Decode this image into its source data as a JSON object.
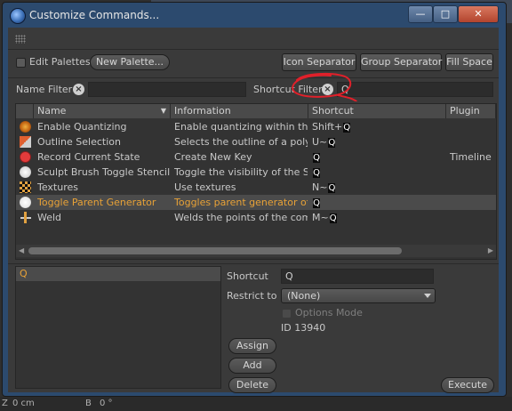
{
  "background": {
    "bottom_fields": [
      "Z",
      "0 cm",
      "B",
      "0 °"
    ]
  },
  "window": {
    "title": "Customize Commands..."
  },
  "toolbar": {
    "edit_palettes_label": "Edit Palettes",
    "new_palette_label": "New Palette...",
    "icon_separator_label": "Icon Separator",
    "group_separator_label": "Group Separator",
    "fill_space_label": "Fill Space"
  },
  "filters": {
    "name_filter_label": "Name Filter",
    "name_filter_value": "",
    "shortcut_filter_label": "Shortcut Filter",
    "shortcut_filter_value": "Q"
  },
  "table": {
    "headers": {
      "name": "Name",
      "information": "Information",
      "shortcut": "Shortcut",
      "plugin": "Plugin"
    },
    "rows": [
      {
        "name": "Enable Quantizing",
        "information": "Enable quantizing within the e",
        "shortcut_prefix": "Shift+",
        "key": "Q",
        "plugin": ""
      },
      {
        "name": "Outline Selection",
        "information": "Selects the outline of a polygo",
        "shortcut_prefix": "U~",
        "key": "Q",
        "plugin": ""
      },
      {
        "name": "Record Current State",
        "information": "Create New Key",
        "shortcut_prefix": "",
        "key": "Q",
        "plugin": "Timeline"
      },
      {
        "name": "Sculpt Brush Toggle Stencil V",
        "information": "Toggle the visibility of the Ste",
        "shortcut_prefix": "",
        "key": "Q",
        "plugin": ""
      },
      {
        "name": "Textures",
        "information": "Use textures",
        "shortcut_prefix": "N~",
        "key": "Q",
        "plugin": ""
      },
      {
        "name": "Toggle Parent Generator",
        "information": "Toggles parent generator of",
        "shortcut_prefix": "",
        "key": "Q",
        "plugin": ""
      },
      {
        "name": "Weld",
        "information": "Welds the points of the comp",
        "shortcut_prefix": "M~",
        "key": "Q",
        "plugin": ""
      }
    ],
    "selected_index": 5
  },
  "details": {
    "shortcut_list_item": "Q",
    "shortcut_label": "Shortcut",
    "shortcut_value": "Q",
    "restrict_label": "Restrict to",
    "restrict_value": "(None)",
    "options_mode_label": "Options Mode",
    "id_text": "ID 13940",
    "assign_label": "Assign",
    "add_label": "Add",
    "delete_label": "Delete",
    "execute_label": "Execute"
  },
  "colors": {
    "selected_text": "#e8a237",
    "annotation": "#e0202a",
    "title_bar": "#2c4a6e"
  }
}
